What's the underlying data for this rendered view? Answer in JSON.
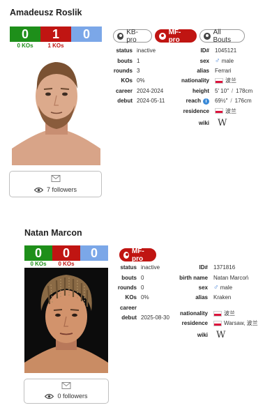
{
  "fighters": [
    {
      "name": "Amadeusz Roslik",
      "record": {
        "wins": "0",
        "losses": "1",
        "draws": "0"
      },
      "kos": {
        "wins": "0 KOs",
        "losses": "1 KOs"
      },
      "tabs": [
        {
          "label": "KB-pro",
          "active": false
        },
        {
          "label": "MF-pro",
          "active": true
        },
        {
          "label": "All Bouts",
          "active": false
        }
      ],
      "left_info": [
        {
          "label": "status",
          "value": "inactive"
        },
        {
          "label": "bouts",
          "value": "1"
        },
        {
          "label": "rounds",
          "value": "3"
        },
        {
          "label": "KOs",
          "value": "0%"
        },
        {
          "label": "career",
          "value": "2024-2024"
        },
        {
          "label": "debut",
          "value": "2024-05-11"
        }
      ],
      "right_info": {
        "id_label": "ID#",
        "id": "1045121",
        "sex_label": "sex",
        "sex_icon": "♂",
        "sex": "male",
        "alias_label": "alias",
        "alias": "Ferrari",
        "nationality_label": "nationality",
        "nationality": "波兰",
        "height_label": "height",
        "height_imperial": "5′ 10″",
        "height_sep": "/",
        "height_metric": "178cm",
        "reach_label": "reach",
        "reach_info_icon": "i",
        "reach_imperial": "69½″",
        "reach_sep": "/",
        "reach_metric": "176cm",
        "residence_label": "residence",
        "residence": "波兰",
        "wiki_label": "wiki",
        "wiki_icon": "W"
      },
      "followers": "7 followers"
    },
    {
      "name": "Natan Marcon",
      "record": {
        "wins": "0",
        "losses": "0",
        "draws": "0"
      },
      "kos": {
        "wins": "0 KOs",
        "losses": "0 KOs"
      },
      "tabs": [
        {
          "label": "MF-pro",
          "active": true
        }
      ],
      "left_info": [
        {
          "label": "status",
          "value": "inactive"
        },
        {
          "label": "bouts",
          "value": "0"
        },
        {
          "label": "rounds",
          "value": "0"
        },
        {
          "label": "KOs",
          "value": "0%"
        },
        {
          "label": "career",
          "value": ""
        },
        {
          "label": "debut",
          "value": "2025-08-30"
        }
      ],
      "right_info": {
        "id_label": "ID#",
        "id": "1371816",
        "birth_name_label": "birth name",
        "birth_name": "Natan Marcoń",
        "sex_label": "sex",
        "sex_icon": "♂",
        "sex": "male",
        "alias_label": "alias",
        "alias": "Kraken",
        "nationality_label": "nationality",
        "nationality": "波兰",
        "residence_label": "residence",
        "residence": "Warsaw, 波兰",
        "wiki_label": "wiki",
        "wiki_icon": "W"
      },
      "followers": "0 followers"
    }
  ],
  "colors": {
    "win": "#1e8f1a",
    "loss": "#c01512",
    "draw": "#7ba7e8",
    "active_tab": "#c01512"
  }
}
